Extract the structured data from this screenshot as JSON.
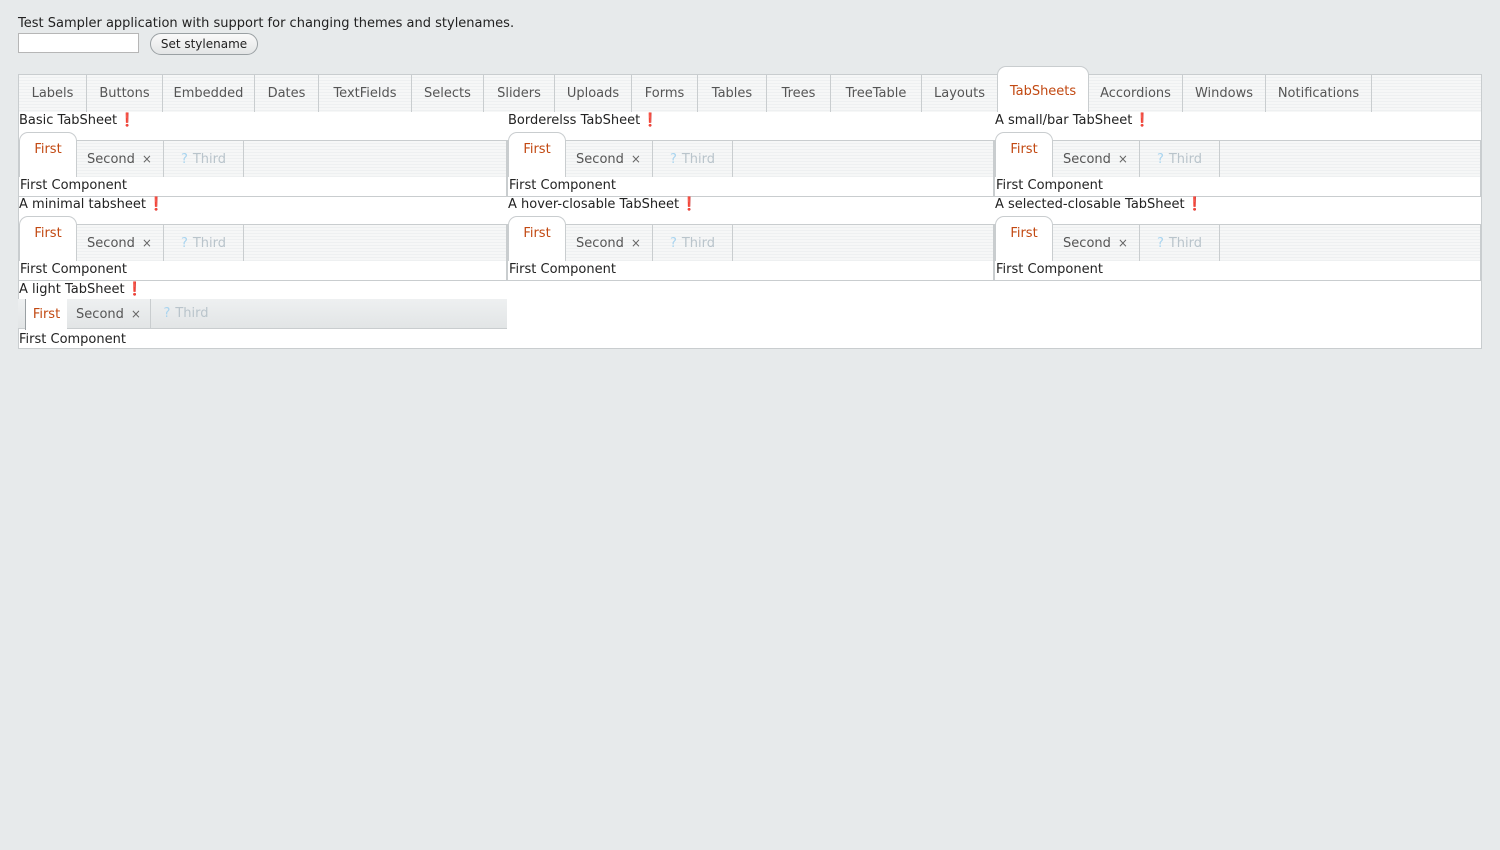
{
  "header": {
    "description": "Test Sampler application with support for changing themes and stylenames.",
    "stylename_value": "",
    "set_stylename_label": "Set stylename"
  },
  "main_tabs": [
    {
      "label": "Labels"
    },
    {
      "label": "Buttons"
    },
    {
      "label": "Embedded"
    },
    {
      "label": "Dates"
    },
    {
      "label": "TextFields"
    },
    {
      "label": "Selects"
    },
    {
      "label": "Sliders"
    },
    {
      "label": "Uploads"
    },
    {
      "label": "Forms"
    },
    {
      "label": "Tables"
    },
    {
      "label": "Trees"
    },
    {
      "label": "TreeTable"
    },
    {
      "label": "Layouts"
    },
    {
      "label": "TabSheets",
      "selected": true
    },
    {
      "label": "Accordions"
    },
    {
      "label": "Windows"
    },
    {
      "label": "Notifications"
    }
  ],
  "required_marker": "❗",
  "tabsheets": [
    {
      "caption": "Basic TabSheet",
      "tabs": {
        "first": "First",
        "second": "Second",
        "third": "Third"
      },
      "content": "First Component"
    },
    {
      "caption": "Borderelss TabSheet",
      "tabs": {
        "first": "First",
        "second": "Second",
        "third": "Third"
      },
      "content": "First Component"
    },
    {
      "caption": "A small/bar TabSheet",
      "tabs": {
        "first": "First",
        "second": "Second",
        "third": "Third"
      },
      "content": "First Component"
    },
    {
      "caption": "A minimal tabsheet",
      "tabs": {
        "first": "First",
        "second": "Second",
        "third": "Third"
      },
      "content": "First Component"
    },
    {
      "caption": "A hover-closable TabSheet",
      "tabs": {
        "first": "First",
        "second": "Second",
        "third": "Third"
      },
      "content": "First Component"
    },
    {
      "caption": "A selected-closable TabSheet",
      "tabs": {
        "first": "First",
        "second": "Second",
        "third": "Third"
      },
      "content": "First Component"
    },
    {
      "caption": "A light TabSheet",
      "tabs": {
        "first": "First",
        "second": "Second",
        "third": "Third"
      },
      "content": "First Component"
    }
  ],
  "glyphs": {
    "close": "×",
    "disabled_icon": "?"
  },
  "colors": {
    "accent": "#c24912",
    "required": "#e4361e",
    "disabled": "#b9c4cb",
    "background": "#e7eaeb"
  }
}
